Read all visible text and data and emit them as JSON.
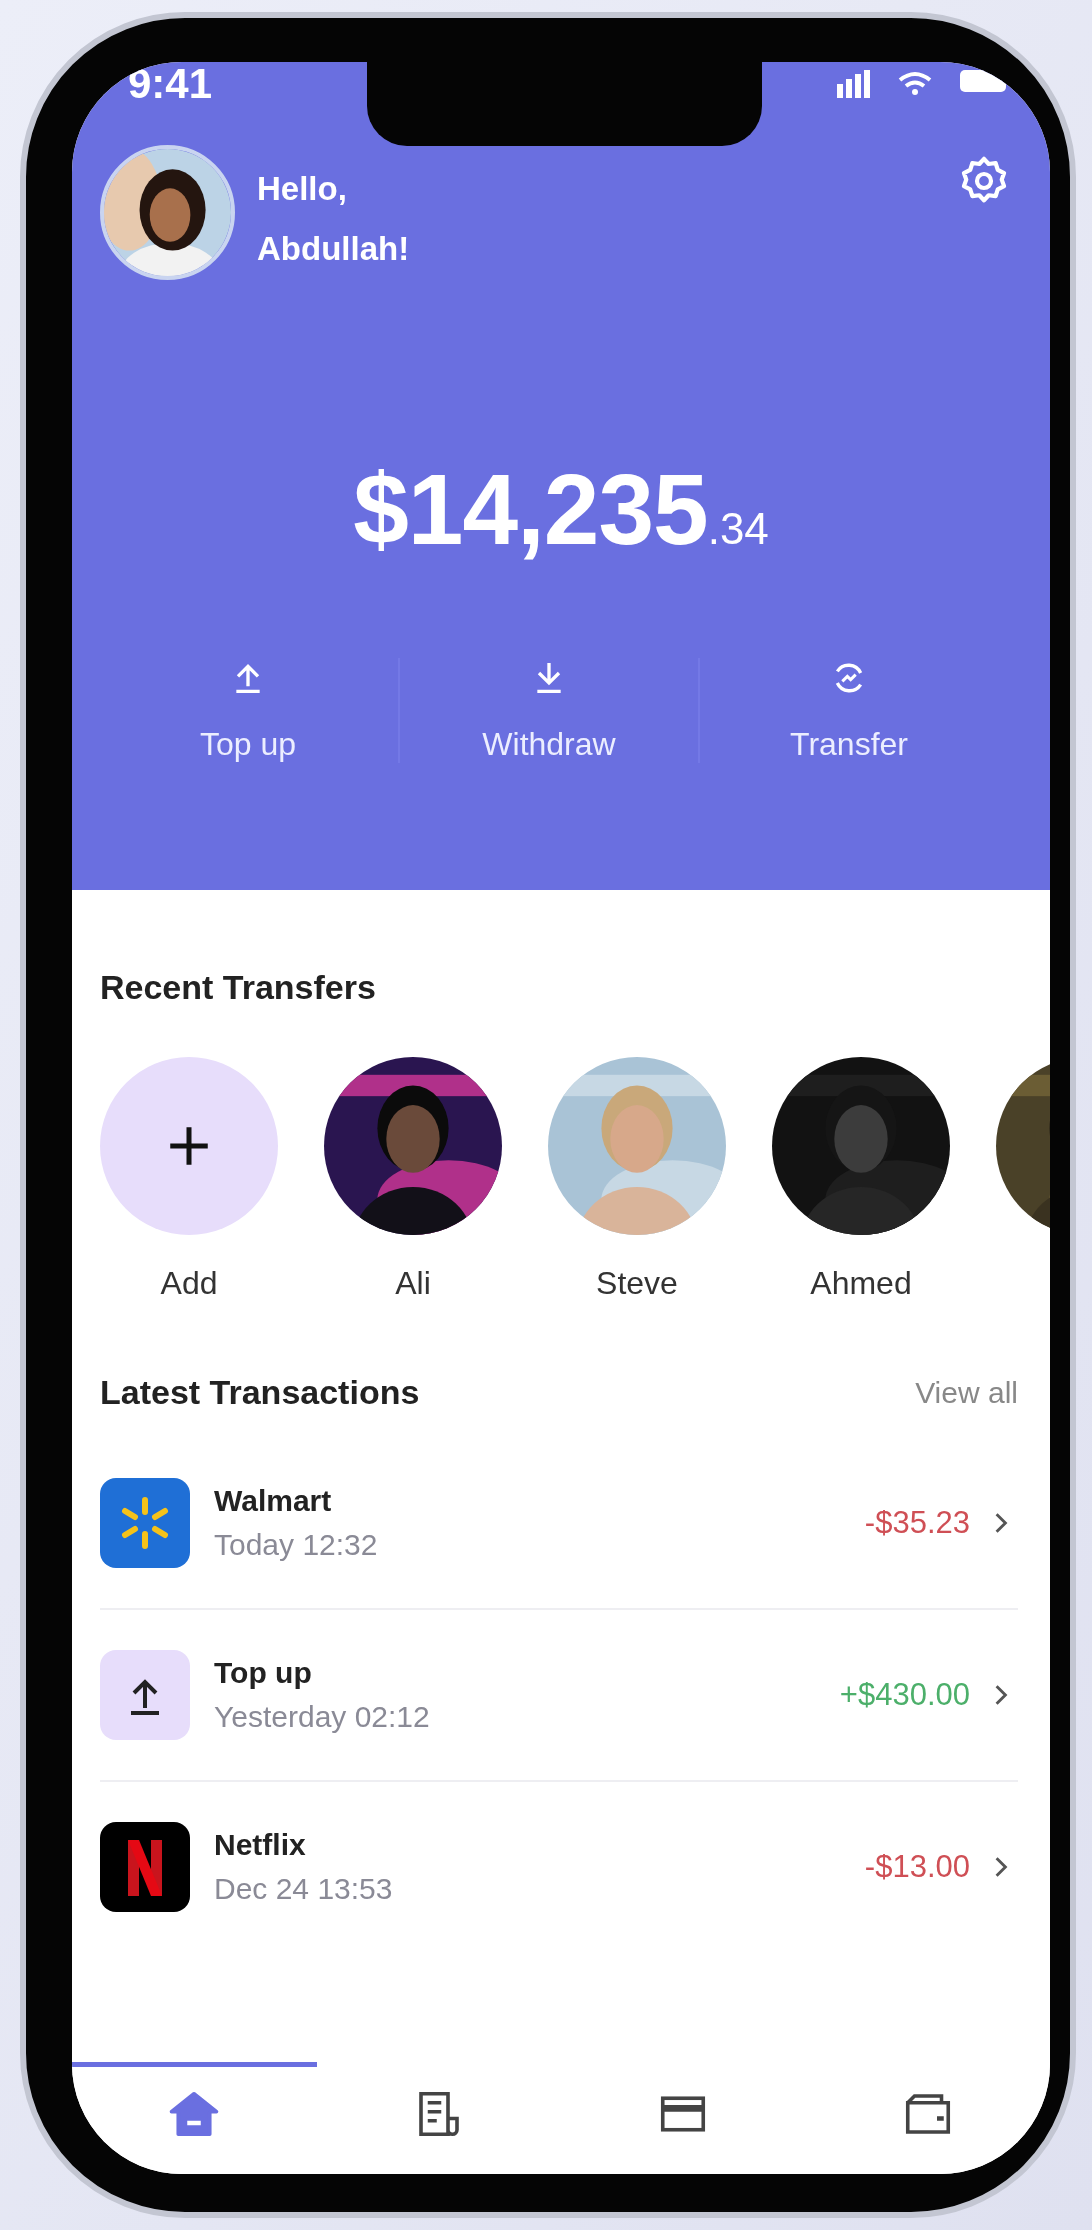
{
  "status_bar": {
    "time": "9:41"
  },
  "header": {
    "greeting": "Hello,",
    "name": "Abdullah!",
    "balance": "$14,235",
    "balance_cents": ".34"
  },
  "actions": [
    {
      "label": "Top up"
    },
    {
      "label": "Withdraw"
    },
    {
      "label": "Transfer"
    }
  ],
  "recent_transfers": {
    "title": "Recent Transfers",
    "items": [
      {
        "kind": "add",
        "name": "Add"
      },
      {
        "kind": "contact",
        "name": "Ali"
      },
      {
        "kind": "contact",
        "name": "Steve"
      },
      {
        "kind": "contact",
        "name": "Ahmed"
      },
      {
        "kind": "contact"
      }
    ]
  },
  "transactions": {
    "title": "Latest Transactions",
    "link": "View all",
    "items": [
      {
        "name": "Walmart",
        "time": "Today 12:32",
        "amount": "-$35.23",
        "kind": "debit"
      },
      {
        "name": "Top up",
        "time": "Yesterday 02:12",
        "amount": "+$430.00",
        "kind": "credit"
      },
      {
        "name": "Netflix",
        "time": "Dec 24 13:53",
        "amount": "-$13.00",
        "kind": "debit"
      }
    ]
  },
  "nav": [
    {
      "selected": true
    },
    {
      "selected": false
    },
    {
      "selected": false
    },
    {
      "selected": false
    }
  ]
}
